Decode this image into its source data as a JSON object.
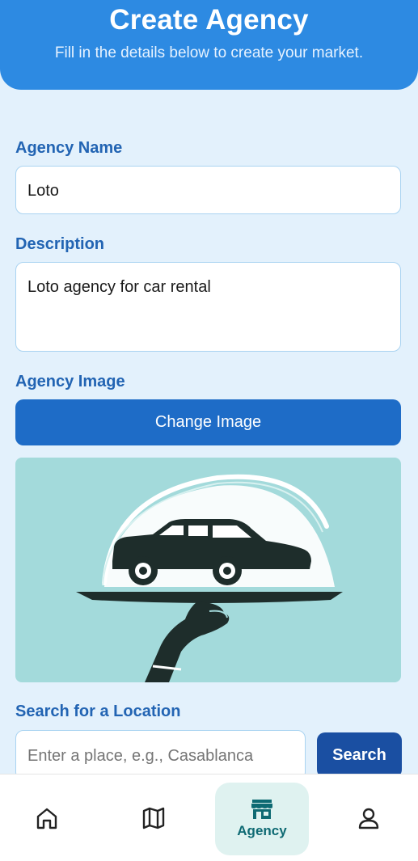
{
  "header": {
    "title": "Create Agency",
    "subtitle": "Fill in the details below to create your market."
  },
  "form": {
    "name_label": "Agency Name",
    "name_value": "Loto",
    "description_label": "Description",
    "description_value": "Loto agency for car rental",
    "image_label": "Agency Image",
    "change_image_label": "Change Image",
    "location_label": "Search for a Location",
    "location_placeholder": "Enter a place, e.g., Casablanca",
    "search_label": "Search"
  },
  "nav": {
    "items": [
      {
        "icon": "home-icon"
      },
      {
        "icon": "map-icon"
      },
      {
        "icon": "store-icon",
        "label": "Agency",
        "active": true
      },
      {
        "icon": "profile-icon"
      }
    ]
  },
  "colors": {
    "header": "#2d8ae2",
    "accent_label": "#2264b3",
    "button": "#1e6cc7",
    "search_button": "#1a4fa2",
    "nav_active": "#0e6a73",
    "image_bg": "#a3dadb"
  }
}
